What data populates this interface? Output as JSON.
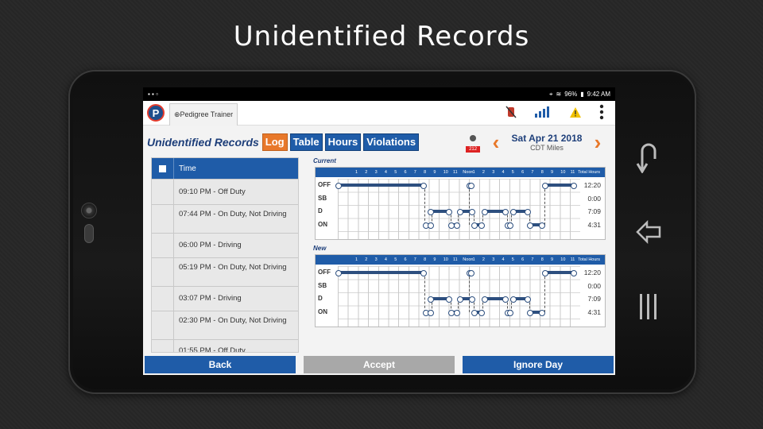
{
  "slide": {
    "title": "Unidentified Records"
  },
  "status_bar": {
    "battery": "96%",
    "time": "9:42 AM"
  },
  "app_header": {
    "user_tab": "⊕Pedigree Trainer",
    "logo_letter": "P"
  },
  "toolbar": {
    "page_heading": "Unidentified Records",
    "tabs": [
      {
        "label": "Log",
        "active": true
      },
      {
        "label": "Table",
        "active": false
      },
      {
        "label": "Hours",
        "active": false
      },
      {
        "label": "Violations",
        "active": false
      }
    ],
    "alert_count": "212",
    "date": "Sat Apr 21 2018",
    "date_sub": "CDT  Miles"
  },
  "records": {
    "header": "Time",
    "items": [
      "09:10 PM - Off Duty",
      "07:44 PM - On Duty, Not Driving",
      "06:00 PM - Driving",
      "05:19 PM - On Duty, Not Driving",
      "03:07 PM - Driving",
      "02:30 PM - On Duty, Not Driving",
      "01:55 PM - Off Duty"
    ]
  },
  "graphs": {
    "hour_labels": [
      "1",
      "2",
      "3",
      "4",
      "5",
      "6",
      "7",
      "8",
      "9",
      "10",
      "11",
      "Noon",
      "1",
      "2",
      "3",
      "4",
      "5",
      "6",
      "7",
      "8",
      "9",
      "10",
      "11"
    ],
    "total_label": "Total Hours",
    "rows": [
      "OFF",
      "SB",
      "D",
      "ON"
    ],
    "current": {
      "label": "Current",
      "totals": [
        "12:20",
        "0:00",
        "7:09",
        "4:31"
      ]
    },
    "new": {
      "label": "New",
      "totals": [
        "12:20",
        "0:00",
        "7:09",
        "4:31"
      ]
    }
  },
  "buttons": {
    "back": "Back",
    "accept": "Accept",
    "ignore": "Ignore Day"
  },
  "colors": {
    "primary": "#1f5ca8",
    "accent": "#e8782a",
    "heading": "#1e3f7a"
  }
}
